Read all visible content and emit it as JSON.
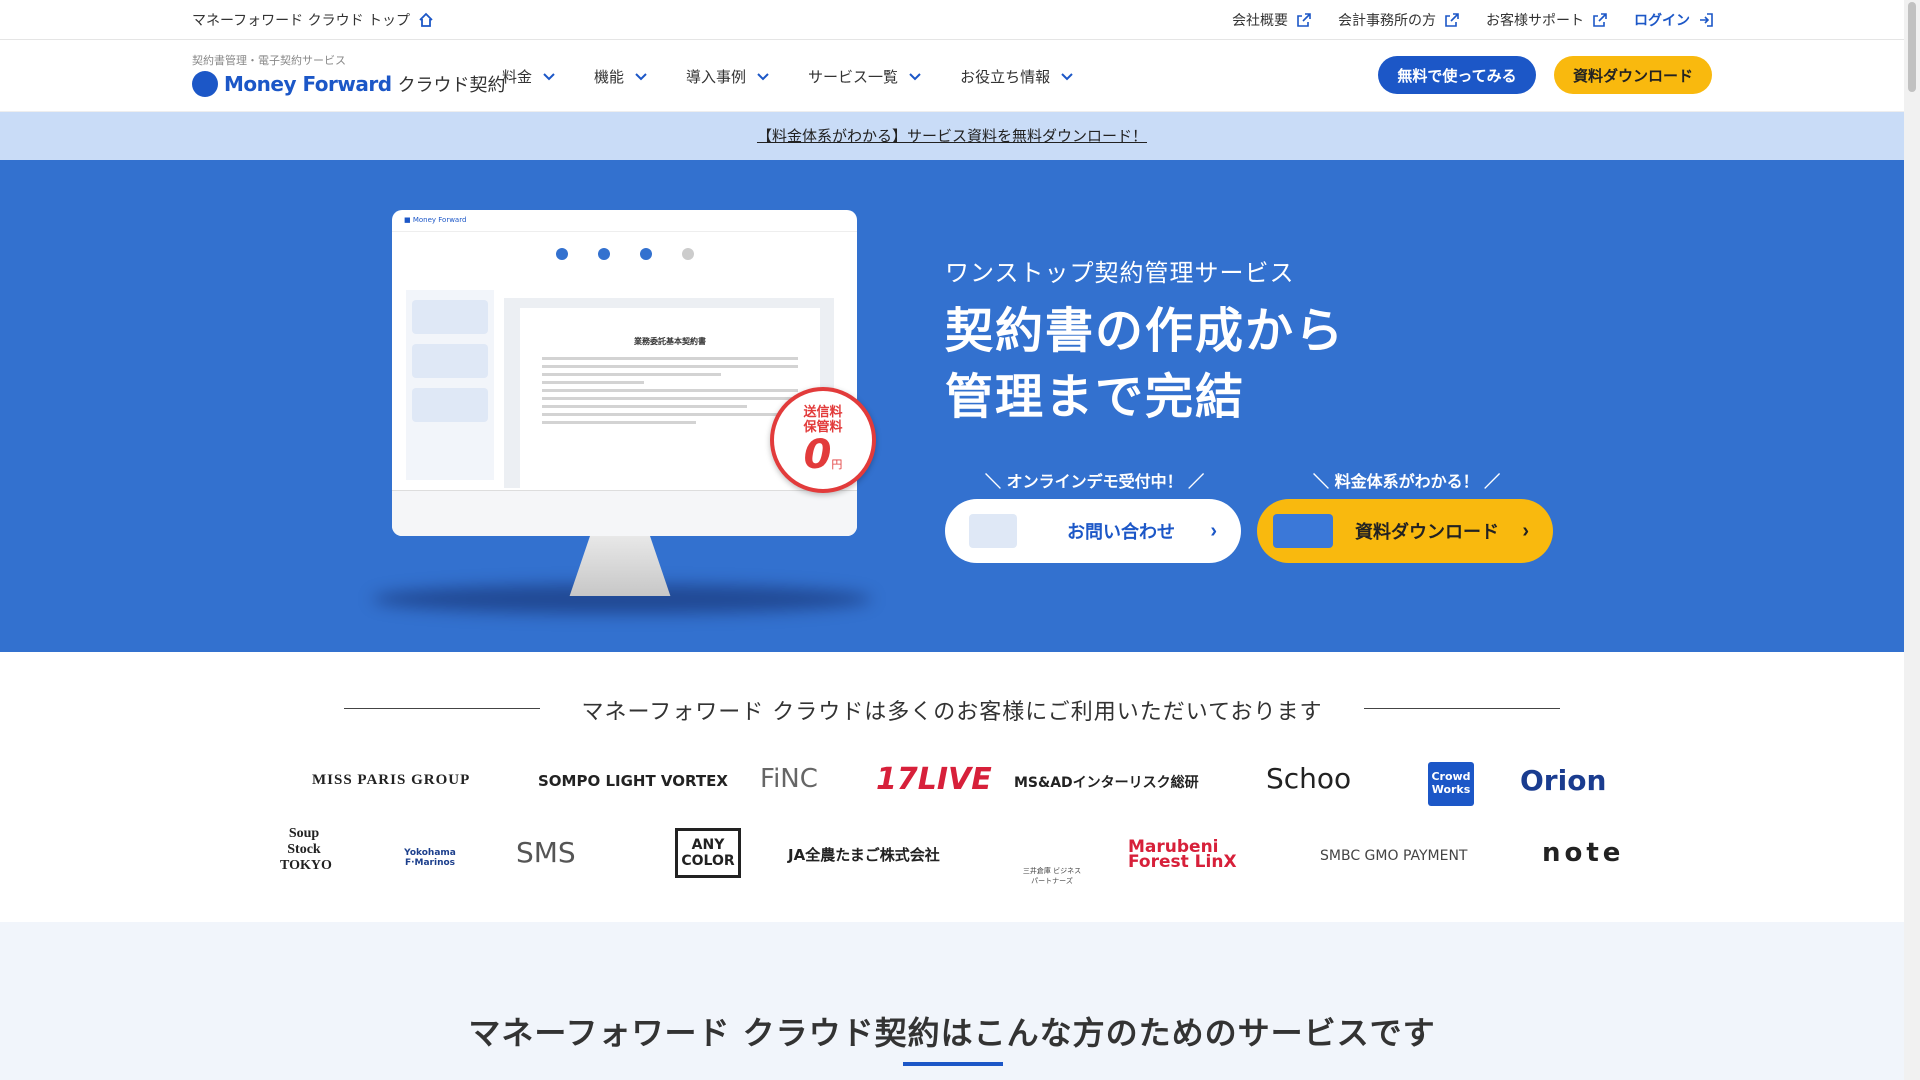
{
  "topbar": {
    "home_link": "マネーフォワード クラウド トップ",
    "links": [
      {
        "label": "会社概要"
      },
      {
        "label": "会計事務所の方"
      },
      {
        "label": "お客様サポート"
      },
      {
        "label": "ログイン"
      }
    ]
  },
  "header": {
    "logo_sub": "契約書管理・電子契約サービス",
    "logo_brand": "Money Forward",
    "logo_product": "クラウド契約",
    "nav": [
      "料金",
      "機能",
      "導入事例",
      "サービス一覧",
      "お役立ち情報"
    ],
    "cta_trial": "無料で使ってみる",
    "cta_download": "資料ダウンロード"
  },
  "banner": {
    "text": "【料金体系がわかる】サービス資料を無料ダウンロード！"
  },
  "hero": {
    "subtitle": "ワンストップ契約管理サービス",
    "title_line1": "契約書の作成から",
    "title_line2": "管理まで完結",
    "caption_demo": "＼ オンラインデモ受付中！ ／",
    "caption_pricing": "＼ 料金体系がわかる！ ／",
    "btn_contact": "お問い合わせ",
    "btn_download": "資料ダウンロード",
    "mock_doc_title": "業務委託基本契約書",
    "stamp_line1": "送信料",
    "stamp_line2": "保管料",
    "stamp_zero": "0",
    "stamp_yen": "円"
  },
  "clients": {
    "heading": "マネーフォワード クラウドは多くのお客様にご利用いただいております",
    "row1": [
      "MISS PARIS GROUP",
      "SOMPO LIGHT VORTEX",
      "FiNC",
      "17LIVE",
      "MS&ADインターリスク総研",
      "Schoo",
      "Crowd Works",
      "Orion"
    ],
    "row2": [
      "Soup Stock TOKYO",
      "Yokohama F·Marinos",
      "SMS",
      "ANY COLOR",
      "JA全農たまご株式会社",
      "三井倉庫 ビジネスパートナーズ",
      "Marubeni Forest LinX",
      "SMBC GMO PAYMENT",
      "note"
    ]
  },
  "section2": {
    "heading": "マネーフォワード クラウド契約はこんな方のためのサービスです"
  },
  "colors": {
    "brand_blue": "#1c57c7",
    "hero_blue": "#3371cf",
    "accent_yellow": "#f9b90e",
    "banner_bg": "#c9dcf7"
  }
}
